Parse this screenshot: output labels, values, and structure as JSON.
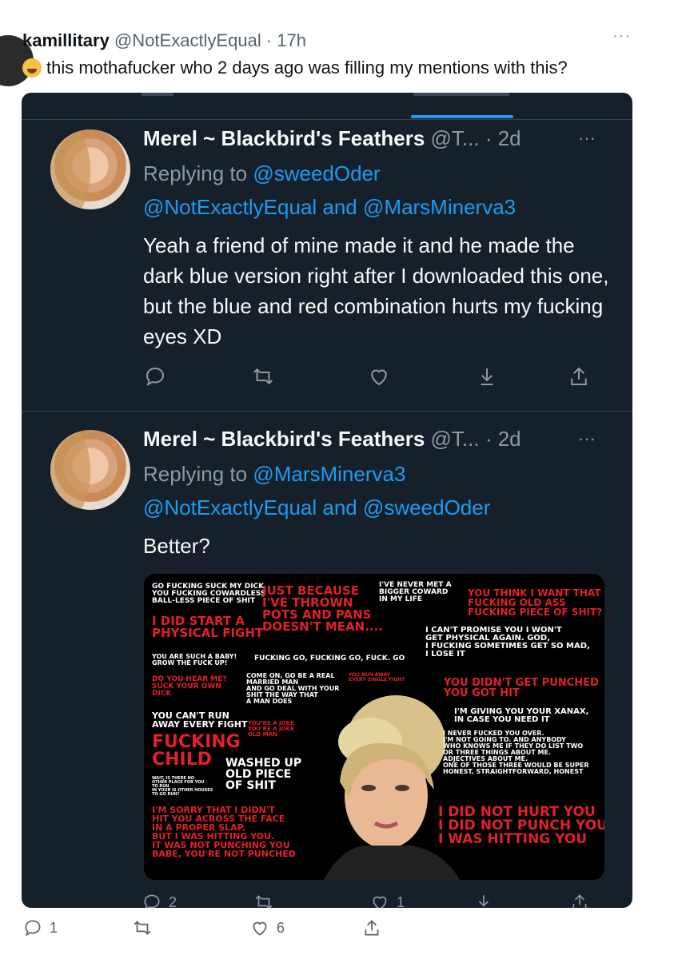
{
  "outer_tweet": {
    "name": "kamillitary",
    "handle": "@NotExactlyEqual",
    "separator": "·",
    "time": "17h",
    "more": "···",
    "emoji": "grinning-squinting-emoji",
    "text": "this mothafucker who 2 days ago was filling my mentions with this?",
    "counts": {
      "replies": "1",
      "likes": "6"
    }
  },
  "screenshot": {
    "tweets": [
      {
        "name": "Merel ~ Blackbird's Feathers",
        "handle_time": "@T... · 2d",
        "more": "···",
        "replying_label": "Replying to",
        "replying_line1_user": "@sweedOder",
        "replying_line2_a": "@NotExactlyEqual",
        "replying_and": "and",
        "replying_line2_b": "@MarsMinerva3",
        "body": "Yeah a friend of mine made it and he made the dark blue version right after I downloaded this one, but the blue and red combination hurts my fucking eyes XD"
      },
      {
        "name": "Merel ~ Blackbird's Feathers",
        "handle_time": "@T... · 2d",
        "more": "···",
        "replying_label": "Replying to",
        "replying_line1_user": "@MarsMinerva3",
        "replying_line2_a": "@NotExactlyEqual",
        "replying_and": "and",
        "replying_line2_b": "@sweedOder",
        "body": "Better?"
      }
    ],
    "bottom_counts": {
      "replies": "2",
      "likes": "1"
    }
  },
  "meme_quotes": [
    "GO FUCKING SUCK MY DICK\nYOU FUCKING COWARDLESS\nBALL-LESS PIECE OF SHIT",
    "JUST BECAUSE\nI'VE THROWN\nPOTS AND PANS\nDOESN'T MEAN....",
    "I'VE NEVER MET A\nBIGGER COWARD\nIN MY LIFE",
    "YOU THINK I WANT THAT\nFUCKING OLD ASS\nFUCKING PIECE OF SHIT?",
    "I DID START A\nPHYSICAL FIGHT",
    "I CAN'T PROMISE YOU I WON'T\nGET PHYSICAL AGAIN. GOD,\nI FUCKING SOMETIMES GET SO MAD,\nI LOSE IT",
    "YOU ARE SUCH A BABY!\nGROW THE FUCK UP!",
    "FUCKING GO, FUCKING GO, FUCK. GO",
    "DO YOU HEAR ME?\nSUCK YOUR OWN\nDICK",
    "COME ON, GO BE A REAL\nMARRIED MAN\nAND GO DEAL WITH YOUR\nSHIT THE WAY THAT\nA MAN DOES",
    "YOU RUN AWAY\nEVERY SINGLE FIGHT",
    "YOU DIDN'T GET PUNCHED\nYOU GOT HIT",
    "YOU CAN'T RUN\nAWAY EVERY FIGHT",
    "YOU'RE A JOKE\nYOU'RE A JOKE\nOLD MAN",
    "I'M GIVING YOU YOUR XANAX,\nIN CASE YOU NEED IT",
    "FUCKING\nCHILD",
    "WASHED UP\nOLD PIECE\nOF SHIT",
    "I NEVER FUCKED YOU OVER.\nI'M NOT GOING TO. AND ANYBODY\nWHO KNOWS ME IF THEY DO LIST TWO\nOR THREE THINGS ABOUT ME.\nADJECTIVES ABOUT ME.\nONE OF THOSE THREE WOULD BE SUPER\nHONEST, STRAIGHTFORWARD, HONEST",
    "WAIT, IS THERE NO\nOTHER PLACE FOR YOU\nTO RUN\nIN YOUR IS OTHER HOUSES\nTO GO RUN?",
    "I'M SORRY THAT I DIDN'T\nHIT YOU ACROSS THE FACE\nIN A PROPER SLAP.\nBUT I WAS HITTING YOU.\nIT WAS NOT PUNCHING YOU\nBABE, YOU'RE NOT PUNCHED",
    "I DID NOT HURT YOU\nI DID NOT PUNCH YOU\nI WAS HITTING YOU"
  ]
}
